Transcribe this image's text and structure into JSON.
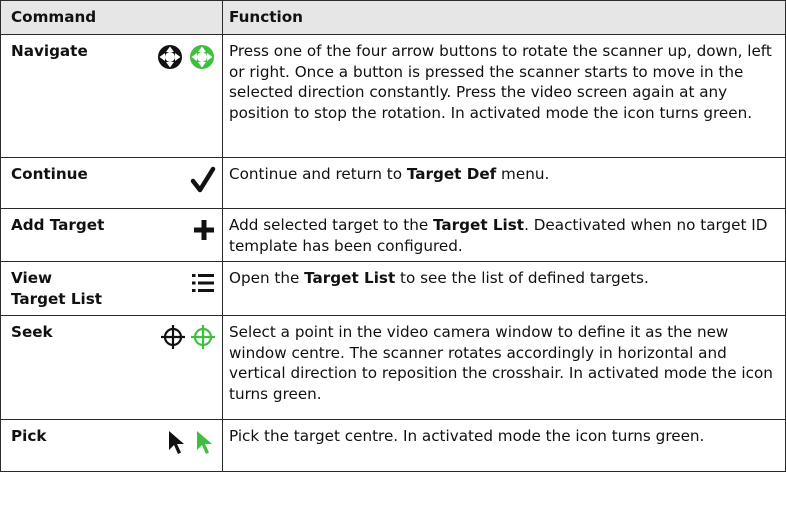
{
  "header": {
    "command": "Command",
    "function": "Function"
  },
  "rows": [
    {
      "command": "Navigate",
      "icons": [
        "navigate-arrows-icon-black",
        "navigate-arrows-icon-green"
      ],
      "function_text": "Press one of the four arrow buttons to rotate the scanner up, down, left or right. Once a button is pressed the scanner starts to move in the selected direction constantly. Press the video screen again at any position to stop the rotation. In activated mode the icon turns green."
    },
    {
      "command": "Continue",
      "icons": [
        "checkmark-icon"
      ],
      "function_pre": "Continue and return to ",
      "function_bold": "Target Def",
      "function_post": " menu."
    },
    {
      "command": "Add Target",
      "icons": [
        "plus-icon"
      ],
      "function_pre": "Add selected target to the ",
      "function_bold": "Target List",
      "function_post": ". Deactivated when no target ID template has been configured."
    },
    {
      "command_line1": "View",
      "command_line2": "Target List",
      "icons": [
        "list-icon"
      ],
      "function_pre": "Open the ",
      "function_bold": "Target List",
      "function_post": " to see the list of defined targets."
    },
    {
      "command": "Seek",
      "icons": [
        "crosshair-icon-black",
        "crosshair-icon-green"
      ],
      "function_text": "Select a point in the video camera window to define it as the new window centre. The scanner rotates accordingly in horizontal and vertical direction to reposition the crosshair. In activated mode the icon turns green."
    },
    {
      "command": "Pick",
      "icons": [
        "cursor-arrow-icon-black",
        "cursor-arrow-icon-green"
      ],
      "function_text": "Pick the target centre. In activated mode the icon turns green."
    }
  ],
  "colors": {
    "header_bg": "#e6e6e6",
    "active_green": "#3fbf3f",
    "icon_black": "#111111"
  }
}
